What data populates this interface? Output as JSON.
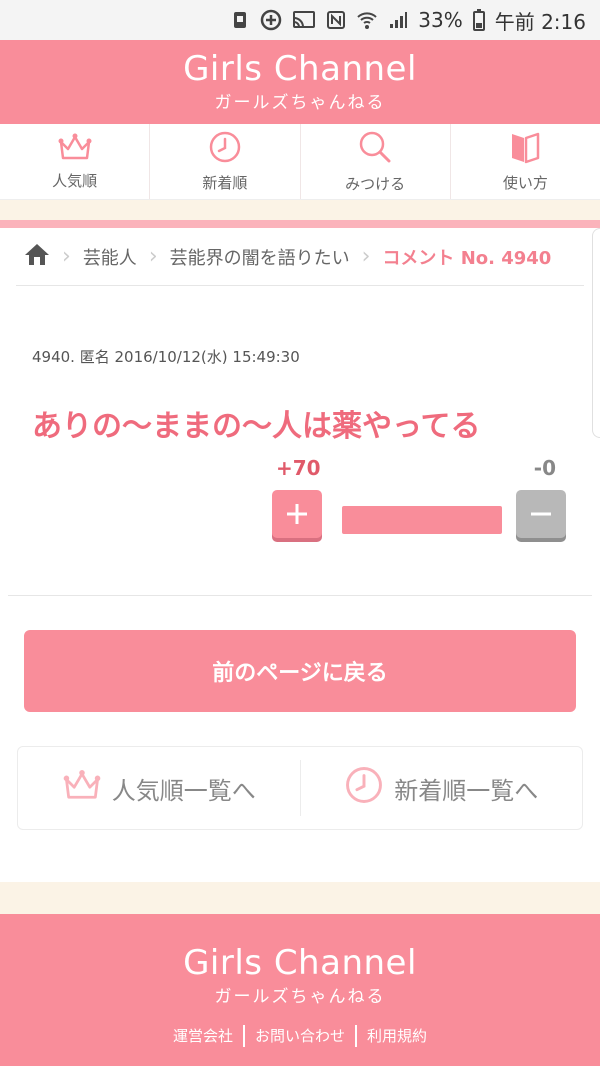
{
  "status_bar": {
    "battery_percent": "33%",
    "time": "午前 2:16"
  },
  "header": {
    "logo_main": "Girls Channel",
    "logo_sub": "ガールズちゃんねる"
  },
  "nav": {
    "items": [
      {
        "label": "人気順",
        "icon": "crown-icon"
      },
      {
        "label": "新着順",
        "icon": "clock-icon"
      },
      {
        "label": "みつける",
        "icon": "search-icon"
      },
      {
        "label": "使い方",
        "icon": "book-icon"
      }
    ]
  },
  "breadcrumb": {
    "items": [
      "芸能人",
      "芸能界の闇を語りたい"
    ],
    "current": "コメント No. 4940"
  },
  "comment": {
    "meta": "4940. 匿名 2016/10/12(水) 15:49:30",
    "body": "ありの～ままの～人は薬やってる",
    "plus": "+70",
    "minus": "-0",
    "vote_ratio": 1.0
  },
  "back_button": {
    "label": "前のページに戻る"
  },
  "list_links": [
    {
      "label": "人気順一覧へ",
      "icon": "crown-icon"
    },
    {
      "label": "新着順一覧へ",
      "icon": "clock-icon"
    }
  ],
  "footer": {
    "logo_main": "Girls Channel",
    "logo_sub": "ガールズちゃんねる",
    "links": [
      "運営会社",
      "お問い合わせ",
      "利用規約"
    ]
  },
  "colors": {
    "brand": "#f98d9a",
    "accent_text": "#ef6b7d",
    "band": "#fbf3e6"
  }
}
